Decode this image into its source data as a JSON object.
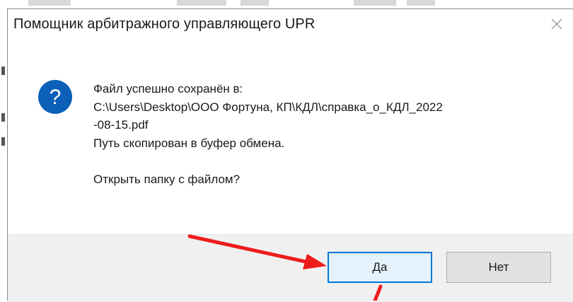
{
  "dialog": {
    "title": "Помощник арбитражного управляющего UPR",
    "icon": "question-icon",
    "message": {
      "line1": "Файл успешно сохранён в:",
      "line2": "C:\\Users\\Desktop\\ООО Фортуна, КП\\КДЛ\\справка_о_КДЛ_2022",
      "line3": "-08-15.pdf",
      "line4": "Путь скопирован в буфер обмена.",
      "line5": "Открыть папку с файлом?"
    },
    "buttons": {
      "yes": "Да",
      "no": "Нет"
    }
  },
  "colors": {
    "accent": "#0078d7",
    "question_icon": "#0a5fb4",
    "annotation_arrow": "#ee1c1c",
    "footer_bg": "#f0f0f0"
  }
}
